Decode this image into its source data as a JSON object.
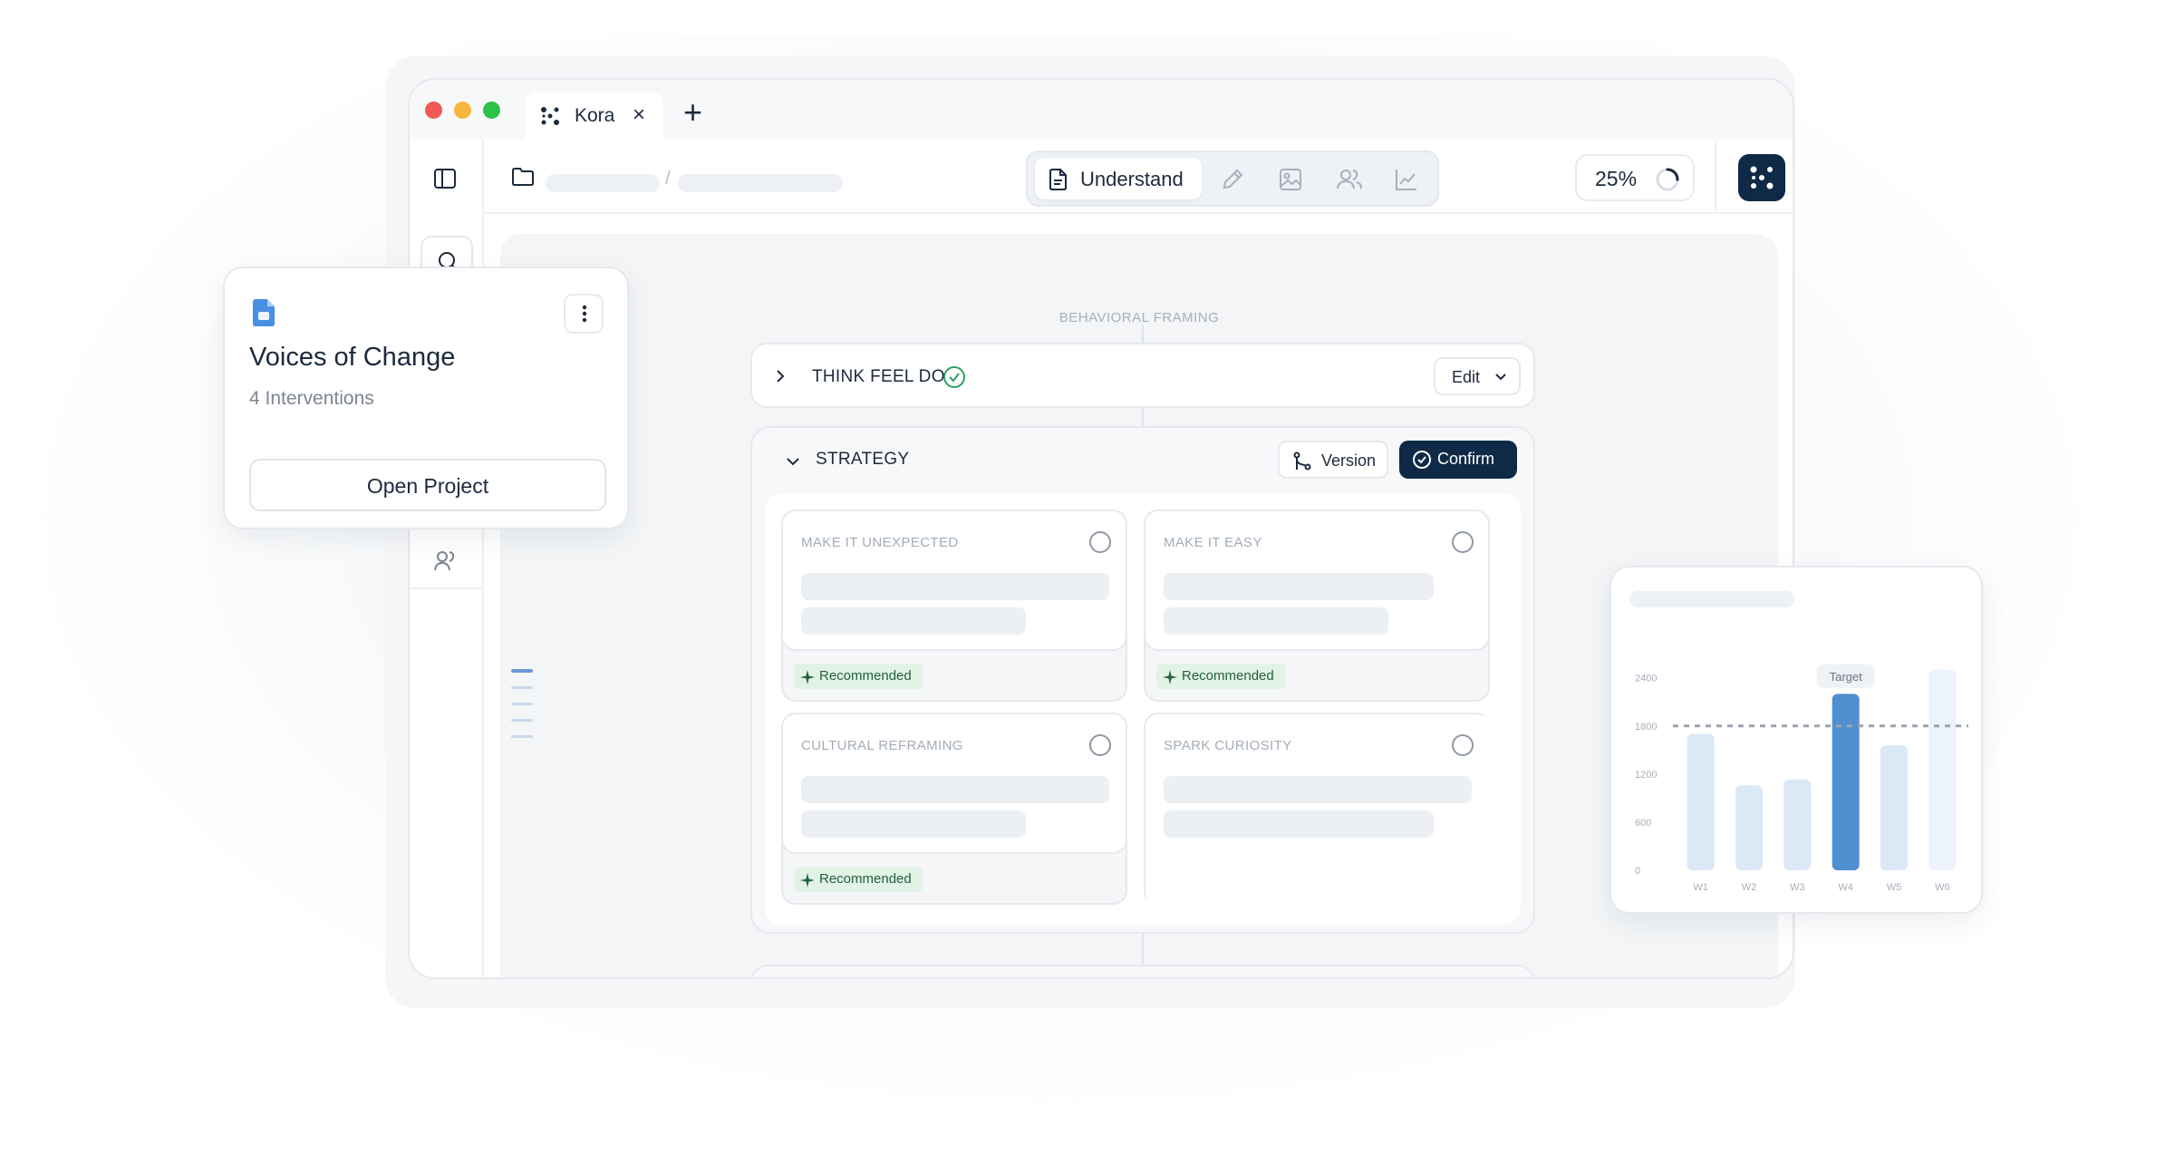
{
  "colors": {
    "accent_dark": "#0f2a47",
    "success_green": "#2f9e63",
    "badge_bg": "#e2f2e7",
    "bar_highlight": "#4f8fcf",
    "bar_light": "#dbe8f6",
    "traffic_red": "#ef5a55",
    "traffic_yellow": "#f6b73c",
    "traffic_green": "#2cc245"
  },
  "browser": {
    "tab_label": "Kora",
    "tab_close": "×",
    "new_tab": "+"
  },
  "toolbar": {
    "breadcrumb_separator": "/",
    "modes": [
      {
        "label": "Understand",
        "icon": "document-icon",
        "active": true
      },
      {
        "icon": "pencil-icon"
      },
      {
        "icon": "image-icon"
      },
      {
        "icon": "users-icon"
      },
      {
        "icon": "line-chart-icon"
      }
    ],
    "progress": "25%",
    "progress_value": 0.25
  },
  "canvas": {
    "section_label": "BEHAVIORAL FRAMING",
    "think_feel_do": {
      "title": "THINK FEEL DO",
      "status": "complete",
      "edit_label": "Edit"
    },
    "strategy": {
      "title": "STRATEGY",
      "version_label": "Version",
      "confirm_label": "Confirm",
      "options": [
        {
          "title": "MAKE IT UNEXPECTED",
          "badge": "Recommended"
        },
        {
          "title": "MAKE IT EASY",
          "badge": "Recommended"
        },
        {
          "title": "CULTURAL REFRAMING",
          "badge": "Recommended"
        },
        {
          "title": "SPARK CURIOSITY",
          "badge": ""
        }
      ]
    }
  },
  "project_card": {
    "title": "Voices of Change",
    "subtitle": "4 Interventions",
    "button_label": "Open Project"
  },
  "chart_data": {
    "type": "bar",
    "title": "",
    "categories": [
      "W1",
      "W2",
      "W3",
      "W4",
      "W5",
      "W6"
    ],
    "values": [
      1700,
      1060,
      1130,
      2200,
      1560,
      2500
    ],
    "highlight_index": 3,
    "target": 1800,
    "target_label": "Target",
    "yticks": [
      0,
      600,
      1200,
      1800,
      2400
    ],
    "ylim": [
      0,
      2600
    ],
    "xlabel": "",
    "ylabel": "",
    "grid": false,
    "legend": "none"
  }
}
